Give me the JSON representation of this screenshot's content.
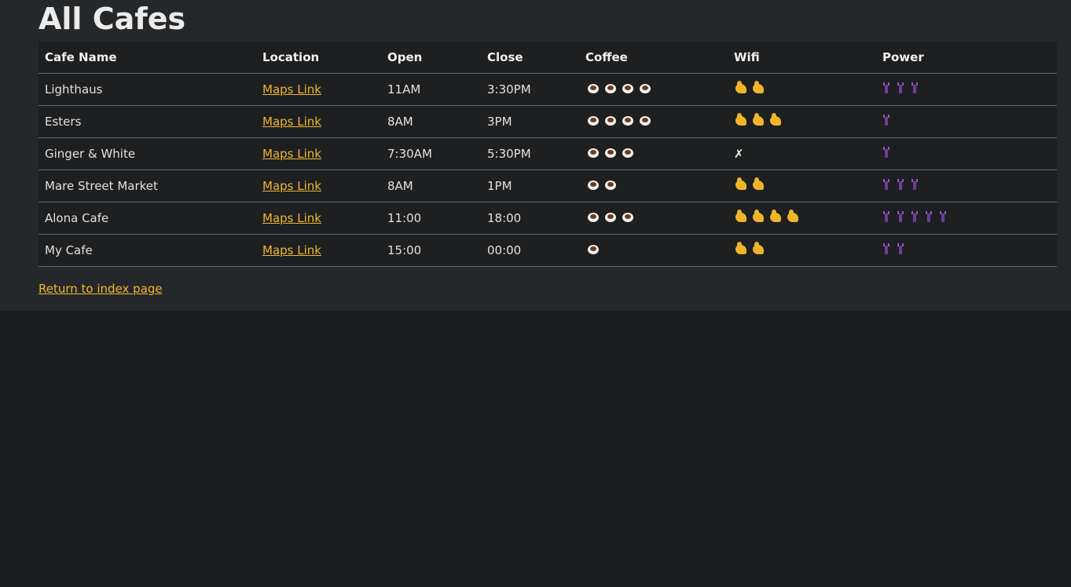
{
  "page": {
    "title": "All Cafes",
    "return_link": "Return to index page"
  },
  "table": {
    "headers": [
      "Cafe Name",
      "Location",
      "Open",
      "Close",
      "Coffee",
      "Wifi",
      "Power"
    ],
    "rows": [
      {
        "name": "Lighthaus",
        "location": "Maps Link",
        "open": "11AM",
        "close": "3:30PM",
        "coffee": 4,
        "wifi": 2,
        "wifi_text": "",
        "power": 3
      },
      {
        "name": "Esters",
        "location": "Maps Link",
        "open": "8AM",
        "close": "3PM",
        "coffee": 4,
        "wifi": 3,
        "wifi_text": "",
        "power": 1
      },
      {
        "name": "Ginger & White",
        "location": "Maps Link",
        "open": "7:30AM",
        "close": "5:30PM",
        "coffee": 3,
        "wifi": 0,
        "wifi_text": "✗",
        "power": 1
      },
      {
        "name": "Mare Street Market",
        "location": "Maps Link",
        "open": "8AM",
        "close": "1PM",
        "coffee": 2,
        "wifi": 2,
        "wifi_text": "",
        "power": 3
      },
      {
        "name": "Alona Cafe",
        "location": "Maps Link",
        "open": "11:00",
        "close": "18:00",
        "coffee": 3,
        "wifi": 4,
        "wifi_text": "",
        "power": 5
      },
      {
        "name": "My Cafe",
        "location": "Maps Link",
        "open": "15:00",
        "close": "00:00",
        "coffee": 1,
        "wifi": 2,
        "wifi_text": "",
        "power": 2
      }
    ]
  },
  "icons": {
    "coffee": "coffee-cup-icon",
    "wifi": "flexed-biceps-icon",
    "power": "electric-plug-icon"
  },
  "colors": {
    "background": "#1b1c1e",
    "panel": "#25282a",
    "table": "#1e1f21",
    "link": "#f1b830",
    "divider": "#66696c"
  }
}
